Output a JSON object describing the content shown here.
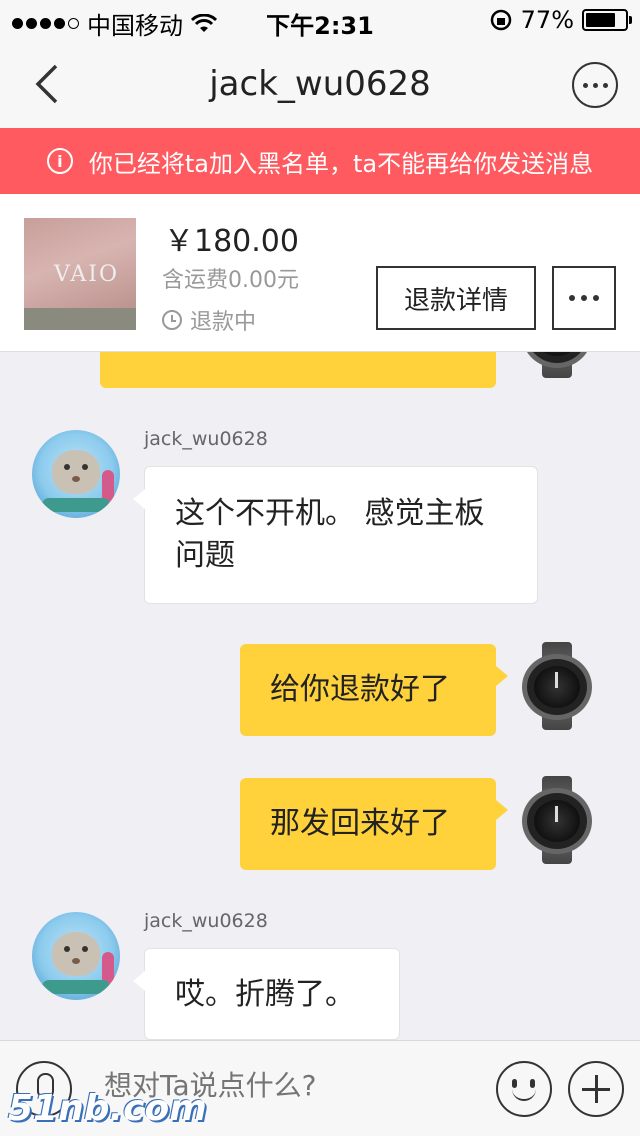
{
  "status_bar": {
    "carrier": "中国移动",
    "time": "下午2:31",
    "battery": "77%",
    "battery_level": 0.77,
    "icons": [
      "signal-dots-icon",
      "wifi-icon",
      "rotation-lock-icon",
      "battery-icon"
    ]
  },
  "nav": {
    "title": "jack_wu0628",
    "back_icon": "chevron-left-icon",
    "more_icon": "more-circle-icon"
  },
  "banner": {
    "text": "你已经将ta加入黑名单，ta不能再给你发送消息",
    "icon_glyph": "i",
    "color": "#ff5a5f"
  },
  "product": {
    "thumb_logo": "VAIO",
    "price": "￥180.00",
    "shipping": "含运费0.00元",
    "status": "退款中",
    "refund_button": "退款详情"
  },
  "messages": [
    {
      "from": "me",
      "text": "",
      "partial": true
    },
    {
      "from": "them",
      "username": "jack_wu0628",
      "lines": [
        "这个不开机。 感觉主板",
        "问题"
      ]
    },
    {
      "from": "me",
      "text": "给你退款好了"
    },
    {
      "from": "me",
      "text": "那发回来好了"
    },
    {
      "from": "them",
      "username": "jack_wu0628",
      "lines": [
        "哎。折腾了。"
      ]
    }
  ],
  "input": {
    "placeholder": "想对Ta说点什么?"
  },
  "watermark": "51nb.com",
  "colors": {
    "my_bubble": "#ffd23c",
    "their_bubble": "#ffffff",
    "background": "#efeff4"
  }
}
